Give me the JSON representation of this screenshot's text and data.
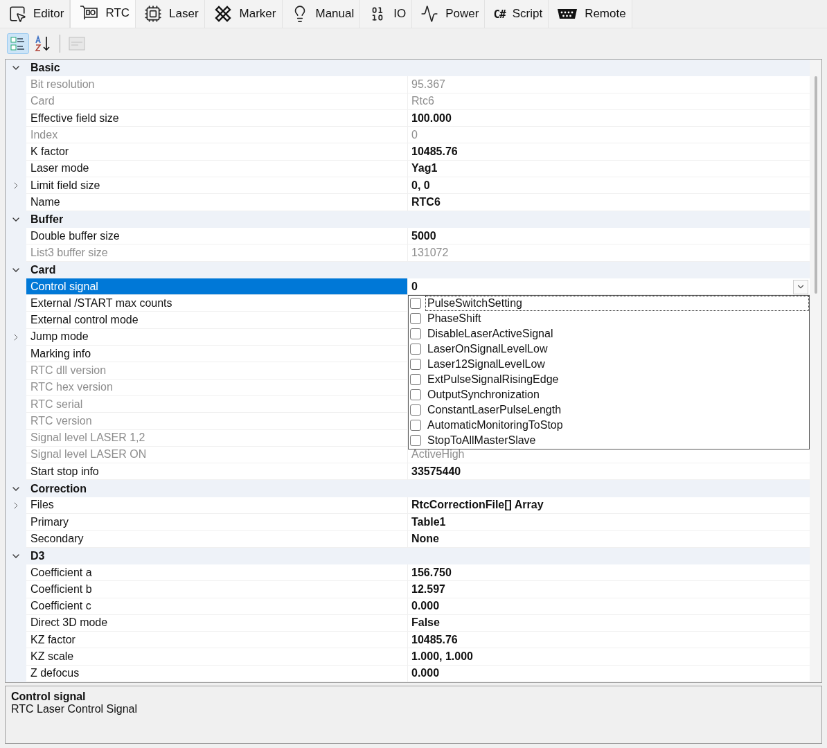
{
  "tabs": [
    {
      "label": "Editor",
      "selected": false
    },
    {
      "label": "RTC",
      "selected": true
    },
    {
      "label": "Laser",
      "selected": false
    },
    {
      "label": "Marker",
      "selected": false
    },
    {
      "label": "Manual",
      "selected": false
    },
    {
      "label": "IO",
      "selected": false
    },
    {
      "label": "Power",
      "selected": false
    },
    {
      "label": "Script",
      "selected": false,
      "icon_text": "C#"
    },
    {
      "label": "Remote",
      "selected": false
    }
  ],
  "toolbar": [
    {
      "kind": "categorized",
      "selected": true,
      "disabled": false
    },
    {
      "kind": "alphabetical",
      "selected": false,
      "disabled": false
    },
    {
      "kind": "pages",
      "selected": false,
      "disabled": true
    }
  ],
  "sections": [
    {
      "title": "Basic",
      "expanded": true,
      "properties": [
        {
          "label": "Bit resolution",
          "value": "95.367",
          "disabled": true,
          "selected": false
        },
        {
          "label": "Card",
          "value": "Rtc6",
          "disabled": true,
          "selected": false
        },
        {
          "label": "Effective field size",
          "value": "100.000",
          "disabled": false,
          "selected": false
        },
        {
          "label": "Index",
          "value": "0",
          "disabled": true,
          "selected": false
        },
        {
          "label": "K factor",
          "value": "10485.76",
          "disabled": false,
          "selected": false
        },
        {
          "label": "Laser mode",
          "value": "Yag1",
          "disabled": false,
          "selected": false
        },
        {
          "label": "Limit field size",
          "value": "0, 0",
          "disabled": false,
          "selected": false,
          "expanded": false
        },
        {
          "label": "Name",
          "value": "RTC6",
          "disabled": false,
          "selected": false
        }
      ]
    },
    {
      "title": "Buffer",
      "expanded": true,
      "properties": [
        {
          "label": "Double buffer size",
          "value": "5000",
          "disabled": false,
          "selected": false
        },
        {
          "label": "List3 buffer size",
          "value": "131072",
          "disabled": true,
          "selected": false
        }
      ]
    },
    {
      "title": "Card",
      "expanded": true,
      "properties": [
        {
          "label": "Control signal",
          "value": "0",
          "disabled": false,
          "selected": true
        },
        {
          "label": "External /START max counts",
          "disabled": false,
          "selected": false
        },
        {
          "label": "External control mode",
          "disabled": false,
          "selected": false
        },
        {
          "label": "Jump mode",
          "disabled": false,
          "selected": false,
          "expanded": false
        },
        {
          "label": "Marking info",
          "disabled": false,
          "selected": false
        },
        {
          "label": "RTC dll version",
          "disabled": true,
          "selected": false
        },
        {
          "label": "RTC hex version",
          "disabled": true,
          "selected": false
        },
        {
          "label": "RTC serial",
          "disabled": true,
          "selected": false
        },
        {
          "label": "RTC version",
          "disabled": true,
          "selected": false
        },
        {
          "label": "Signal level LASER 1,2",
          "disabled": true,
          "selected": false
        },
        {
          "label": "Signal level LASER ON",
          "value": "ActiveHigh",
          "disabled": true,
          "selected": false
        },
        {
          "label": "Start stop info",
          "value": "33575440",
          "disabled": false,
          "selected": false
        }
      ]
    },
    {
      "title": "Correction",
      "expanded": true,
      "properties": [
        {
          "label": "Files",
          "value": "RtcCorrectionFile[] Array",
          "disabled": false,
          "selected": false,
          "expanded": false
        },
        {
          "label": "Primary",
          "value": "Table1",
          "disabled": false,
          "selected": false
        },
        {
          "label": "Secondary",
          "value": "None",
          "disabled": false,
          "selected": false
        }
      ]
    },
    {
      "title": "D3",
      "expanded": true,
      "properties": [
        {
          "label": "Coefficient a",
          "value": "156.750",
          "disabled": false,
          "selected": false
        },
        {
          "label": "Coefficient b",
          "value": "12.597",
          "disabled": false,
          "selected": false
        },
        {
          "label": "Coefficient c",
          "value": "0.000",
          "disabled": false,
          "selected": false
        },
        {
          "label": "Direct 3D mode",
          "value": "False",
          "disabled": false,
          "selected": false
        },
        {
          "label": "KZ factor",
          "value": "10485.76",
          "disabled": false,
          "selected": false
        },
        {
          "label": "KZ scale",
          "value": "1.000, 1.000",
          "disabled": false,
          "selected": false
        },
        {
          "label": "Z defocus",
          "value": "0.000",
          "disabled": false,
          "selected": false
        }
      ]
    }
  ],
  "dropdown": {
    "open": true,
    "options": [
      {
        "label": "PulseSwitchSetting",
        "checked": false,
        "focused": true
      },
      {
        "label": "PhaseShift",
        "checked": false,
        "focused": false
      },
      {
        "label": "DisableLaserActiveSignal",
        "checked": false,
        "focused": false
      },
      {
        "label": "LaserOnSignalLevelLow",
        "checked": false,
        "focused": false
      },
      {
        "label": "Laser12SignalLevelLow",
        "checked": false,
        "focused": false
      },
      {
        "label": "ExtPulseSignalRisingEdge",
        "checked": false,
        "focused": false
      },
      {
        "label": "OutputSynchronization",
        "checked": false,
        "focused": false
      },
      {
        "label": "ConstantLaserPulseLength",
        "checked": false,
        "focused": false
      },
      {
        "label": "AutomaticMonitoringToStop",
        "checked": false,
        "focused": false
      },
      {
        "label": "StopToAllMasterSlave",
        "checked": false,
        "focused": false
      }
    ]
  },
  "description": {
    "title": "Control signal",
    "text": "RTC Laser Control Signal"
  }
}
